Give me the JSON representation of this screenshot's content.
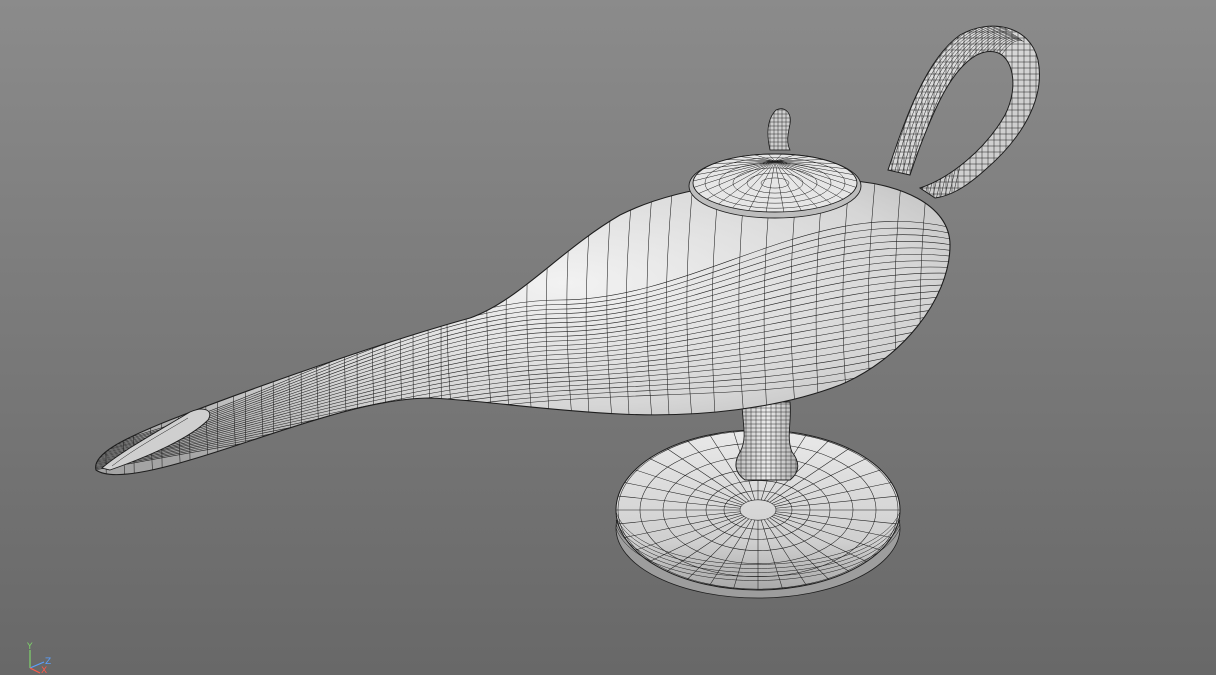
{
  "viewport": {
    "background_top": "#8b8b8b",
    "background_bottom": "#686868"
  },
  "model": {
    "type": "wireframe-on-shaded",
    "object": "lamp",
    "surface_color": "#d9d9d9",
    "wire_color": "#1e1e1e"
  },
  "axis_gizmo": {
    "y_label": "Y",
    "z_label": "Z",
    "x_label": "X",
    "y_color": "#7fd36b",
    "z_color": "#5aa0ff",
    "x_color": "#ff5a4a"
  }
}
